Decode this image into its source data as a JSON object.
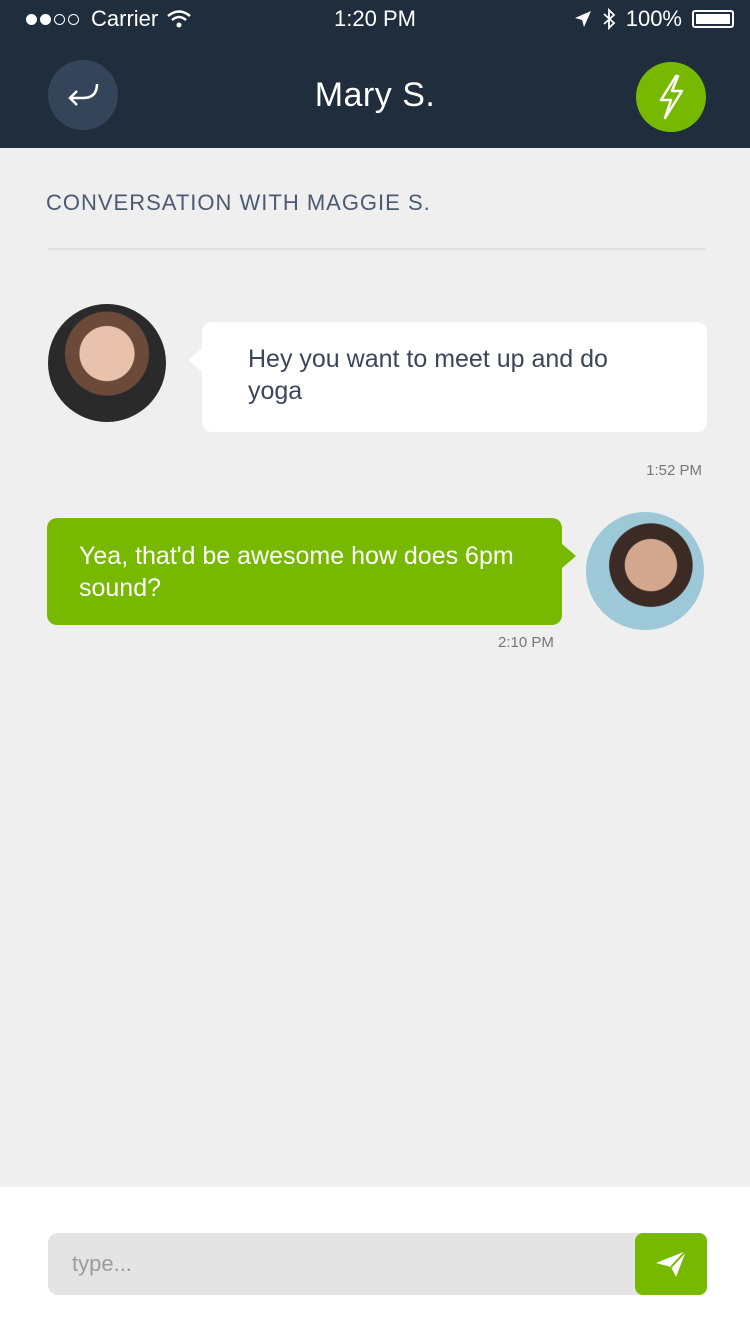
{
  "status_bar": {
    "carrier": "Carrier",
    "time": "1:20 PM",
    "battery": "100%"
  },
  "header": {
    "title": "Mary S.",
    "back_icon": "back-arrow-icon",
    "action_icon": "lightning-bolt-icon",
    "accent_color": "#76b900",
    "bar_color": "#1f2d3d"
  },
  "conversation": {
    "label": "CONVERSATION WITH MAGGIE S."
  },
  "messages": [
    {
      "direction": "incoming",
      "text": "Hey you want to meet up and do yoga",
      "timestamp": "1:52 PM"
    },
    {
      "direction": "outgoing",
      "text": "Yea, that'd be awesome how does 6pm sound?",
      "timestamp": "2:10 PM"
    }
  ],
  "composer": {
    "placeholder": "type...",
    "send_icon": "paper-plane-icon"
  }
}
